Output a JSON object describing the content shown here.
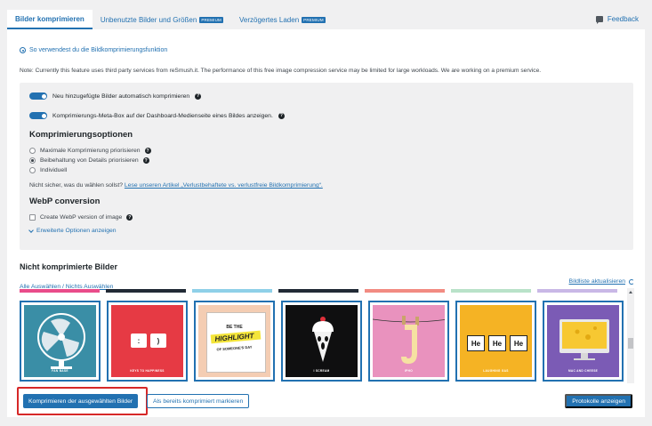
{
  "tabs": [
    {
      "label": "Bilder komprimieren",
      "badge": ""
    },
    {
      "label": "Unbenutzte Bilder und Größen",
      "badge": "PREMIUM"
    },
    {
      "label": "Verzögertes Laden",
      "badge": "PREMIUM"
    }
  ],
  "feedback": "Feedback",
  "howto": "So verwendest du die Bildkomprimierungsfunktion",
  "note": "Note: Currently this feature uses third party services from reSmush.it. The performance of this free image compression service may be limited for large workloads. We are working on a premium service.",
  "toggles": {
    "auto": "Neu hinzugefügte Bilder automatisch komprimieren",
    "metabox": "Komprimierungs-Meta-Box auf der Dashboard-Medienseite eines Bildes anzeigen."
  },
  "options_title": "Komprimierungsoptionen",
  "options": [
    "Maximale Komprimierung priorisieren",
    "Beibehaltung von Details priorisieren",
    "Individuell"
  ],
  "unsure_text": "Nicht sicher, was du wählen sollst? ",
  "unsure_link": "Lese unseren Artikel „Verlustbehaftete vs. verlustfreie Bildkomprimierung“.",
  "webp_title": "WebP conversion",
  "webp_option": "Create WebP version of image",
  "advanced": "Erweiterte Optionen anzeigen",
  "uncompressed_title": "Nicht komprimierte Bilder",
  "refresh": "Bildliste aktualisieren",
  "select_all": "Alle Auswählen / Nichts Auswählen",
  "thumbs": [
    {
      "caption": "FAN BASE",
      "icon": "fan-image"
    },
    {
      "caption": "KEYS TO HAPPINESS",
      "icon": "keys-image",
      "keys": [
        ":",
        ")"
      ]
    },
    {
      "caption": "",
      "icon": "highlight-image",
      "lines": [
        "BE THE",
        "HIGHLIGHT",
        "OF SOMEONE'S DAY"
      ]
    },
    {
      "caption": "I SCREAM",
      "icon": "ice-cream-image"
    },
    {
      "caption": "IPHO",
      "icon": "clothesline-image"
    },
    {
      "caption": "LAUGHING GAS",
      "icon": "helium-image",
      "elements": [
        "He",
        "He",
        "He"
      ]
    },
    {
      "caption": "MAC AND CHEESE",
      "icon": "mac-cheese-image"
    }
  ],
  "strip_colors": [
    "#e94c8a",
    "#222b36",
    "#8fd0e8",
    "#222b36",
    "#f28b82",
    "#b9e2c9",
    "#c9b8e6"
  ],
  "buttons": {
    "compress": "Komprimieren der ausgewählten Bilder",
    "mark": "Als bereits komprimiert markieren",
    "logs": "Protokolle anzeigen"
  }
}
